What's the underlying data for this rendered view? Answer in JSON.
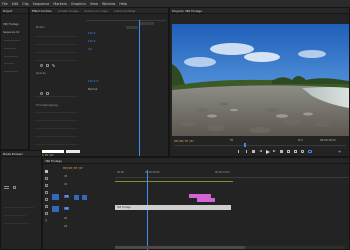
{
  "menu": [
    "File",
    "Edit",
    "Clip",
    "Sequence",
    "Markers",
    "Graphics",
    "View",
    "Window",
    "Help"
  ],
  "effect_controls": {
    "tabs": [
      "Effect Controls",
      "Lumetri Scopes",
      "Source: (no clips)",
      "Audio Clip Mixer"
    ],
    "value_a": "100.0",
    "value_b": "100.0",
    "value_c": "0.0",
    "value_d": "100.0 %",
    "value_e": "Normal",
    "label_1": "Motion",
    "label_2": "Opacity",
    "label_3": "Time Remapping",
    "timecode": "00;00;07;07"
  },
  "program_monitor": {
    "title": "Program: 360 Footage",
    "timecode": "00;00;07;07",
    "fit": "Fit",
    "quality": "Full",
    "duration": "00;00;18;12"
  },
  "project": {
    "tabs": [
      "Project",
      "Media Browser"
    ],
    "items": [
      "360 Footage",
      "Sequence 01"
    ]
  },
  "timeline": {
    "tab": "360 Footage",
    "timecode": "00;00;07;07",
    "ruler": [
      "00;00",
      "00;00;08;00",
      "00;00;16;00"
    ],
    "clip_video": "360 Footage",
    "clip_fx": "fx",
    "tracks": [
      "V3",
      "V2",
      "V1",
      "A1",
      "A2",
      "A3"
    ]
  },
  "colors": {
    "accent": "#3d8ef0",
    "timecode": "#e0b14a",
    "clip_pink": "#d463d8",
    "clip_grey": "#cfcfcf"
  }
}
